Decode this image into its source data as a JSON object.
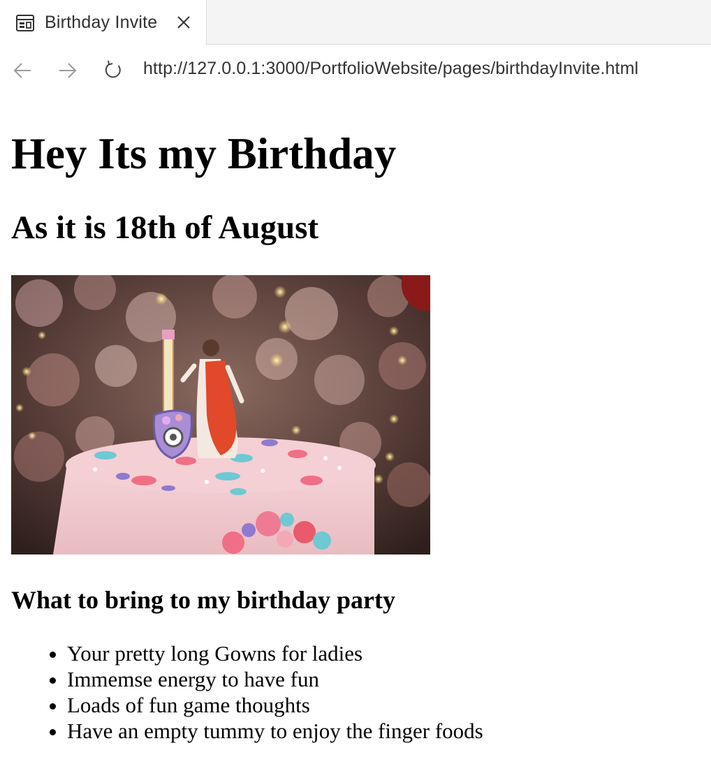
{
  "browser": {
    "tab": {
      "title": "Birthday Invite",
      "icon": "page-layout-icon",
      "close_icon": "close-icon"
    },
    "nav": {
      "back_icon": "arrow-left-icon",
      "forward_icon": "arrow-right-icon",
      "reload_icon": "reload-icon",
      "url": "http://127.0.0.1:3000/PortfolioWebsite/pages/birthdayInvite.html"
    }
  },
  "page": {
    "title": "Hey Its my Birthday",
    "subtitle": "As it is 18th of August",
    "section_heading": "What to bring to my birthday party",
    "items": [
      "Your pretty long Gowns for ladies",
      "Immemse energy to have fun",
      "Loads of fun game thoughts",
      "Have an empty tummy to enjoy the finger foods"
    ]
  },
  "colors": {
    "tabstrip_bg": "#f4f4f4",
    "cake_frosting": "#f2c9cf",
    "sari_red": "#e2482a",
    "backdrop_dark": "#5a3a36"
  }
}
